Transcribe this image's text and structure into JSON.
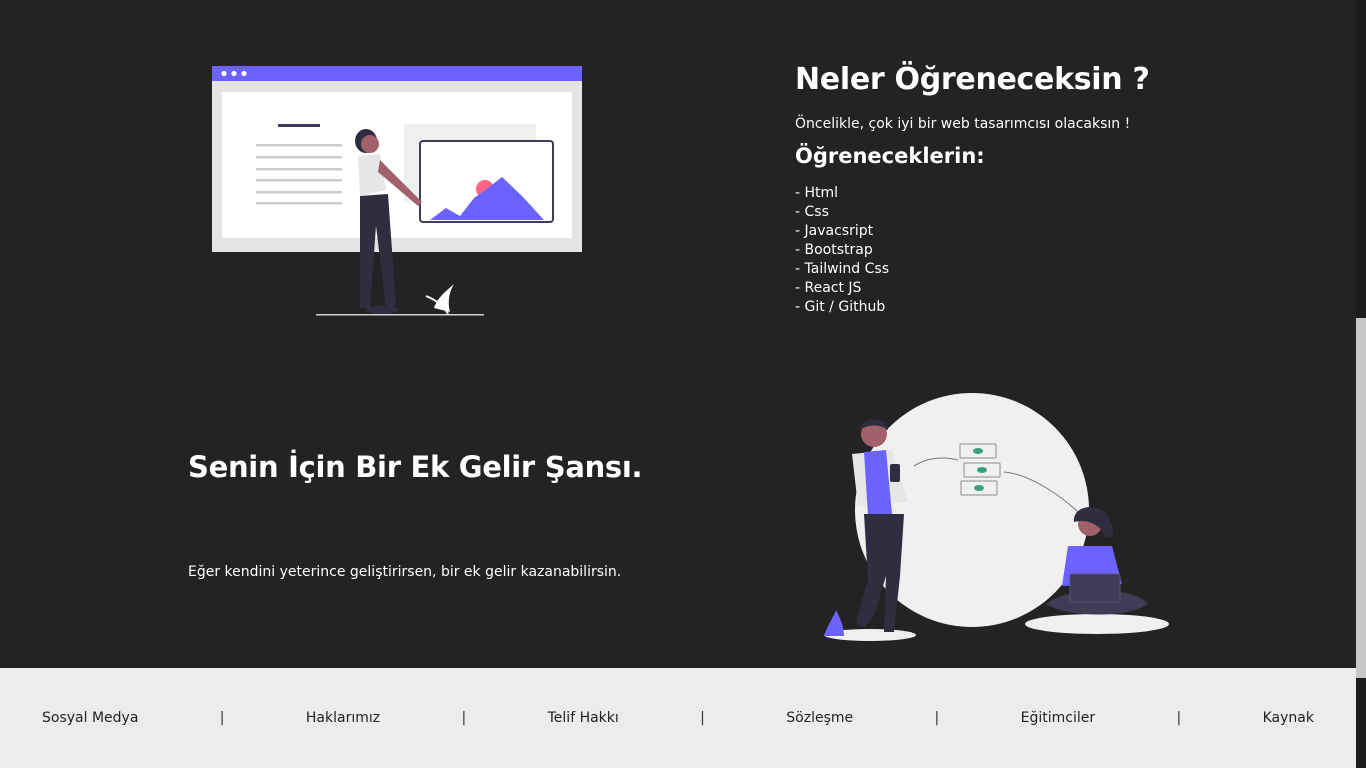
{
  "section1": {
    "title": "Neler Öğreneceksin ?",
    "intro": "Öncelikle, çok iyi bir web tasarımcısı olacaksın !",
    "subtitle": "Öğreneceklerin:",
    "items": [
      "- Html",
      "- Css",
      "- Javacsript",
      "- Bootstrap",
      "- Tailwind Css",
      "- React JS",
      "- Git / Github"
    ]
  },
  "section2": {
    "title": "Senin İçin Bir Ek Gelir Şansı.",
    "text": "Eğer kendini yeterince geliştirirsen, bir ek gelir kazanabilirsin."
  },
  "footer": {
    "links": [
      "Sosyal Medya",
      "Haklarımız",
      "Telif Hakkı",
      "Sözleşme",
      "Eğitimciler",
      "Kaynak"
    ],
    "separator": "|"
  },
  "colors": {
    "background": "#232323",
    "accent": "#6c63ff",
    "footer_bg": "#ececec"
  },
  "icons": [
    "presentation-illustration",
    "earning-illustration"
  ]
}
